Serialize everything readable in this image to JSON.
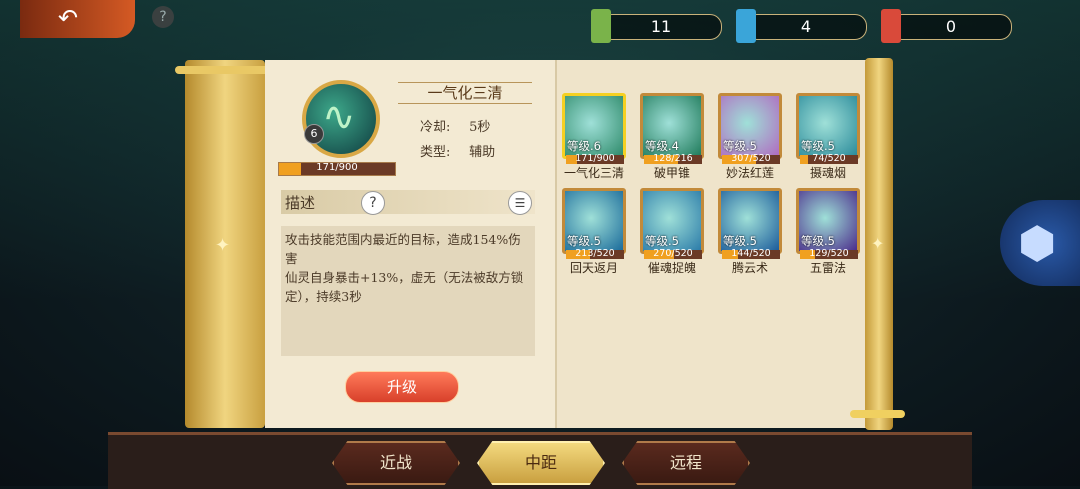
{
  "resources": [
    {
      "name": "green-scroll",
      "value": "11",
      "color": "#7ab34a"
    },
    {
      "name": "blue-scroll",
      "value": "4",
      "color": "#3aa5d9"
    },
    {
      "name": "red-scroll",
      "value": "0",
      "color": "#d94a3a"
    }
  ],
  "skill": {
    "name": "一气化三清",
    "level": "6",
    "xp_text": "171/900",
    "xp_fraction": 0.19,
    "cooldown_label": "冷却:",
    "cooldown_value": "5秒",
    "type_label": "类型:",
    "type_value": "辅助"
  },
  "description": {
    "title": "描述",
    "text": "攻击技能范围内最近的目标，造成154%伤害\n仙灵自身暴击+13%，虚无（无法被敌方锁定），持续3秒"
  },
  "upgrade_label": "升级",
  "skills": [
    {
      "name": "一气化三清",
      "level": "等级.6",
      "progress": "171/900",
      "fraction": 0.19,
      "selected": true,
      "color": "#2e8a6a"
    },
    {
      "name": "破甲锥",
      "level": "等级.4",
      "progress": "128/216",
      "fraction": 0.59,
      "selected": false,
      "color": "#1f7a5a"
    },
    {
      "name": "妙法红莲",
      "level": "等级.5",
      "progress": "307/520",
      "fraction": 0.59,
      "selected": false,
      "color": "#b06ac0"
    },
    {
      "name": "摄魂烟",
      "level": "等级.5",
      "progress": "74/520",
      "fraction": 0.14,
      "selected": false,
      "color": "#2a8a9a"
    },
    {
      "name": "回天返月",
      "level": "等级.5",
      "progress": "213/520",
      "fraction": 0.41,
      "selected": false,
      "color": "#1a6a9a"
    },
    {
      "name": "催魂捉魄",
      "level": "等级.5",
      "progress": "270/520",
      "fraction": 0.52,
      "selected": false,
      "color": "#2a7aa8"
    },
    {
      "name": "腾云术",
      "level": "等级.5",
      "progress": "144/520",
      "fraction": 0.28,
      "selected": false,
      "color": "#1a5a9a"
    },
    {
      "name": "五雷法",
      "level": "等级.5",
      "progress": "129/520",
      "fraction": 0.25,
      "selected": false,
      "color": "#4a2a8a"
    }
  ],
  "tabs": [
    {
      "label": "近战",
      "active": false
    },
    {
      "label": "中距",
      "active": true
    },
    {
      "label": "远程",
      "active": false
    }
  ]
}
